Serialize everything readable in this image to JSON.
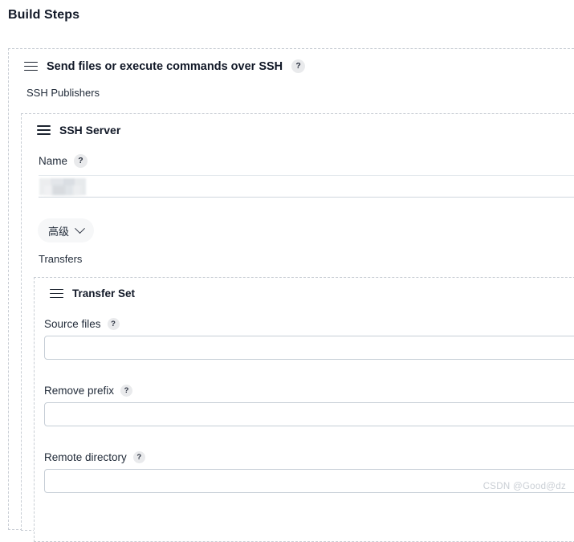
{
  "page": {
    "title": "Build Steps",
    "watermark": "CSDN @Good@dz"
  },
  "icons": {
    "drag_handle": "hamburger-icon",
    "help": "?",
    "chevron_down": "chevron-down-icon"
  },
  "build_step": {
    "header_title": "Send files or execute commands over SSH",
    "header_help": "?",
    "publishers_caption": "SSH Publishers"
  },
  "ssh_server": {
    "header_title": "SSH Server",
    "name_label": "Name",
    "name_help": "?",
    "name_value": "",
    "name_placeholder": "",
    "advanced_button": "高级",
    "transfers_caption": "Transfers"
  },
  "transfer_set": {
    "header_title": "Transfer Set",
    "fields": [
      {
        "label": "Source files",
        "help": "?",
        "value": "",
        "placeholder": ""
      },
      {
        "label": "Remove prefix",
        "help": "?",
        "value": "",
        "placeholder": ""
      },
      {
        "label": "Remote directory",
        "help": "?",
        "value": "",
        "placeholder": ""
      }
    ]
  },
  "colors": {
    "panel_border": "#c8cdd4",
    "input_border": "#c6ced6",
    "pill_bg": "#f6f7f8",
    "help_bg": "#e9eaec",
    "text": "#1f2937",
    "watermark": "#c9ced4"
  }
}
